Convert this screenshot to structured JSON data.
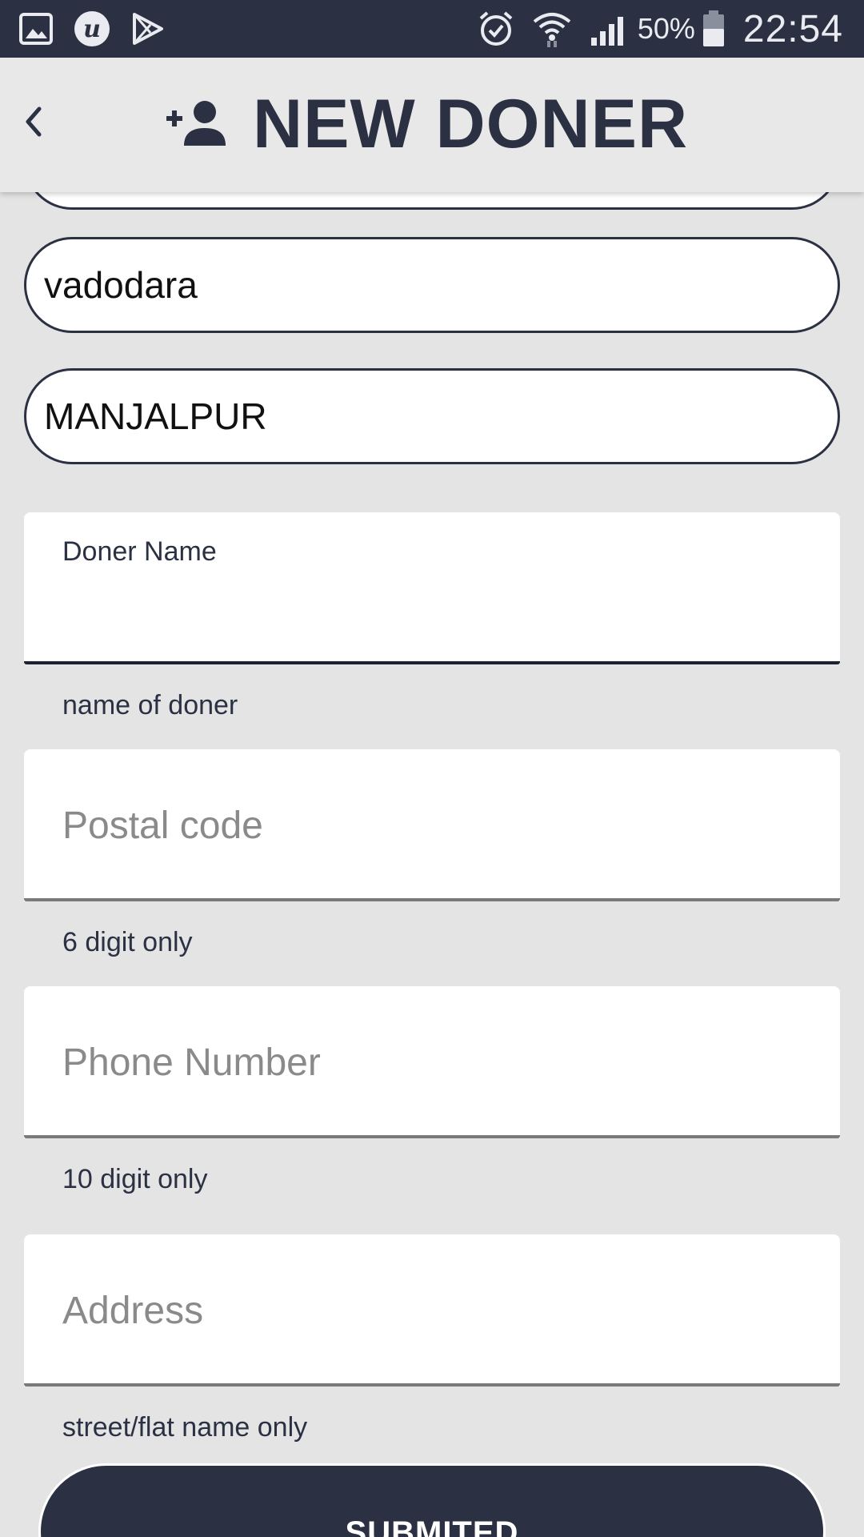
{
  "status_bar": {
    "battery_percent": "50%",
    "time": "22:54",
    "left_icons": [
      "gallery-icon",
      "u-app-icon",
      "play-store-icon"
    ],
    "right_icons": [
      "alarm-icon",
      "wifi-icon",
      "signal-icon",
      "battery-icon"
    ]
  },
  "header": {
    "title": "NEW DONER",
    "back_icon": "chevron-left-icon",
    "title_icon": "person-add-icon"
  },
  "form": {
    "city_value": "vadodara",
    "area_value": "MANJALPUR",
    "doner_name": {
      "label": "Doner Name",
      "value": "",
      "helper": "name of doner"
    },
    "postal_code": {
      "placeholder": "Postal code",
      "helper": "6 digit only"
    },
    "phone_number": {
      "placeholder": "Phone Number",
      "helper": "10 digit only"
    },
    "address": {
      "placeholder": "Address",
      "helper": "street/flat name only"
    },
    "submit_label": "SUBMITED"
  },
  "colors": {
    "primary": "#2b3143",
    "background": "#e4e4e4",
    "field": "#ffffff",
    "placeholder": "#8a8a8a"
  }
}
